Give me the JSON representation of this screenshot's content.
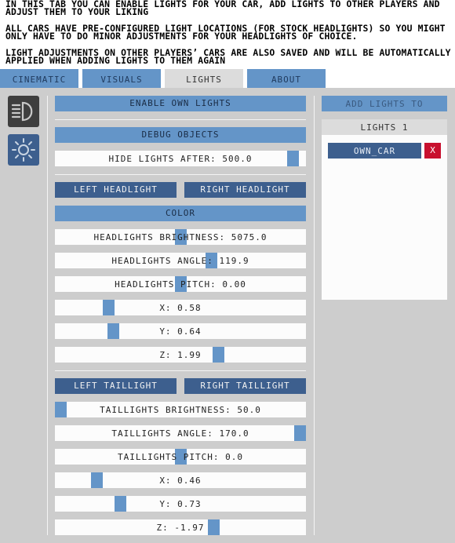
{
  "info": {
    "line1": "IN THIS TAB YOU CAN ENABLE LIGHTS FOR YOUR CAR, ADD LIGHTS TO OTHER PLAYERS AND",
    "line2": "ADJUST THEM TO YOUR LIKING",
    "line3": "ALL CARS HAVE PRE-CONFIGURED LIGHT LOCATIONS (FOR STOCK HEADLIGHTS) SO YOU MIGHT",
    "line4": "ONLY HAVE TO DO MINOR ADJUSTMENTS FOR YOUR HEADLIGHTS OF CHOICE.",
    "line5": "LIGHT ADJUSTMENTS ON OTHER PLAYERS’ CARS ARE ALSO SAVED AND WILL BE AUTOMATICALLY",
    "line6": "APPLIED WHEN ADDING LIGHTS TO THEM AGAIN"
  },
  "tabs": {
    "cinematic": "CINEMATIC",
    "visuals": "VISUALS",
    "lights": "LIGHTS",
    "about": "ABOUT",
    "active": "LIGHTS"
  },
  "sidebar_icons": [
    "headlight-icon",
    "sun-icon"
  ],
  "main": {
    "enable_own_lights": "ENABLE OWN LIGHTS",
    "debug_objects": "DEBUG OBJECTS",
    "hide_lights": {
      "label": "HIDE LIGHTS AFTER: 500.0",
      "level": 0.97
    },
    "left_headlight": "LEFT HEADLIGHT",
    "right_headlight": "RIGHT HEADLIGHT",
    "color": "COLOR",
    "headlight_sliders": [
      {
        "label": "HEADLIGHTS BRIGHTNESS: 5075.0",
        "level": 0.5
      },
      {
        "label": "HEADLIGHTS ANGLE: 119.9",
        "level": 0.63
      },
      {
        "label": "HEADLIGHTS PITCH: 0.00",
        "level": 0.5
      },
      {
        "label": "X: 0.58",
        "level": 0.2
      },
      {
        "label": "Y: 0.64",
        "level": 0.22
      },
      {
        "label": "Z: 1.99",
        "level": 0.66
      }
    ],
    "left_taillight": "LEFT TAILLIGHT",
    "right_taillight": "RIGHT TAILLIGHT",
    "taillight_sliders": [
      {
        "label": "TAILLIGHTS BRIGHTNESS: 50.0",
        "level": 0.0
      },
      {
        "label": "TAILLIGHTS ANGLE: 170.0",
        "level": 1.0
      },
      {
        "label": "TAILLIGHTS PITCH: 0.0",
        "level": 0.5
      },
      {
        "label": "X: 0.46",
        "level": 0.15
      },
      {
        "label": "Y: 0.73",
        "level": 0.25
      },
      {
        "label": "Z: -1.97",
        "level": 0.64
      }
    ]
  },
  "right": {
    "add_lights_to": "ADD LIGHTS TO",
    "lights_header": "LIGHTS 1",
    "lights": [
      {
        "name": "OWN_CAR",
        "remove": "X"
      }
    ]
  },
  "colors": {
    "accent": "#6495c8",
    "accent_dark": "#3d5f8e",
    "remove": "#c8102e",
    "background": "#cdcdcd"
  }
}
